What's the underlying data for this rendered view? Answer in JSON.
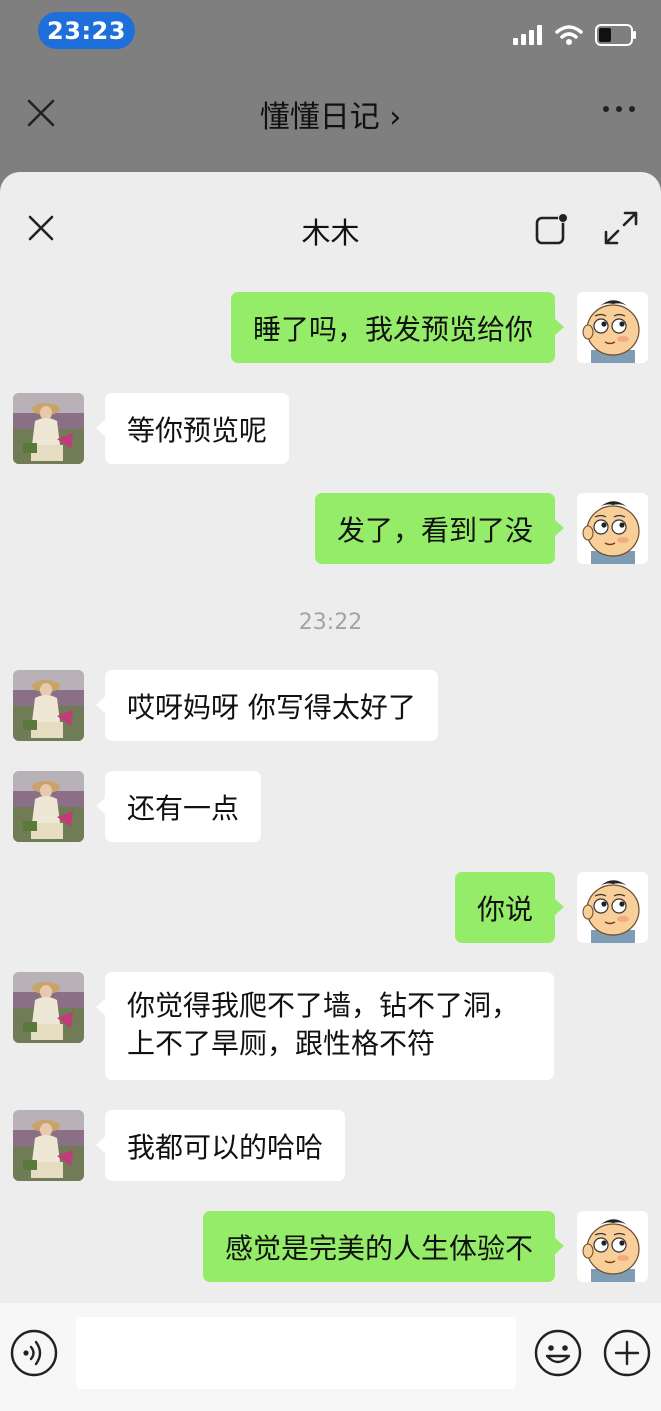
{
  "status_bar": {
    "time": "23:23"
  },
  "background_nav": {
    "title": "懂懂日记",
    "chevron": "›"
  },
  "sheet": {
    "title": "木木"
  },
  "messages": [
    {
      "side": "out",
      "text": "睡了吗，我发预览给你"
    },
    {
      "side": "in",
      "text": "等你预览呢"
    },
    {
      "side": "out",
      "text": "发了，看到了没"
    },
    {
      "side": "in",
      "text": "哎呀妈呀 你写得太好了"
    },
    {
      "side": "in",
      "text": "还有一点"
    },
    {
      "side": "out",
      "text": "你说"
    },
    {
      "side": "in",
      "line1": "你觉得我爬不了墙，钻不了洞，",
      "line2": "上不了旱厕，跟性格不符"
    },
    {
      "side": "in",
      "text": "我都可以的哈哈"
    },
    {
      "side": "out",
      "text": "感觉是完美的人生体验不"
    }
  ],
  "timestamp": "23:22",
  "input": {
    "value": "",
    "placeholder": ""
  },
  "icons": {
    "status": [
      "signal-icon",
      "wifi-icon",
      "battery-icon"
    ],
    "nav": [
      "close-icon",
      "more-icon"
    ],
    "sheet": [
      "close-icon",
      "floating-window-icon",
      "expand-icon"
    ],
    "input_bar": [
      "voice-icon",
      "emoji-icon",
      "plus-icon"
    ]
  },
  "colors": {
    "outgoing_bubble": "#95ec69",
    "incoming_bubble": "#ffffff",
    "background": "#ededed",
    "time_pill": "#1e6fd9"
  }
}
